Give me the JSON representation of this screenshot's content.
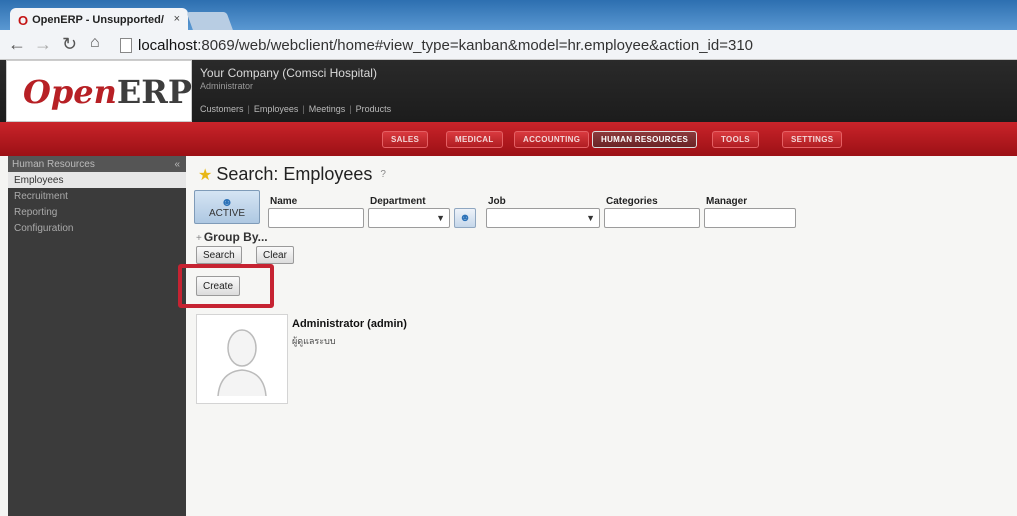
{
  "browser": {
    "tab_title": "OpenERP - Unsupported/",
    "tab_close": "×",
    "url_host": "localhost",
    "url_rest": ":8069/web/webclient/home#view_type=kanban&model=hr.employee&action_id=310"
  },
  "header": {
    "logo_open": "Open",
    "logo_erp": "ERP",
    "company": "Your Company (Comsci Hospital)",
    "user": "Administrator",
    "shortcuts": [
      "Customers",
      "Employees",
      "Meetings",
      "Products"
    ]
  },
  "menu": {
    "items": [
      "SALES",
      "MEDICAL",
      "ACCOUNTING",
      "HUMAN RESOURCES",
      "TOOLS",
      "SETTINGS"
    ],
    "active": "HUMAN RESOURCES"
  },
  "sidebar": {
    "header": "Human Resources",
    "collapse": "«",
    "items": [
      "Employees",
      "Recruitment",
      "Reporting",
      "Configuration"
    ]
  },
  "main": {
    "title": "Search: Employees",
    "help": "?",
    "filter_active": "ACTIVE",
    "fields": {
      "name": "Name",
      "department": "Department",
      "job": "Job",
      "categories": "Categories",
      "manager": "Manager"
    },
    "group_by": "Group By...",
    "search_btn": "Search",
    "clear_btn": "Clear",
    "create_btn": "Create",
    "card": {
      "name": "Administrator (admin)",
      "sub": "ผู้ดูแลระบบ"
    }
  }
}
